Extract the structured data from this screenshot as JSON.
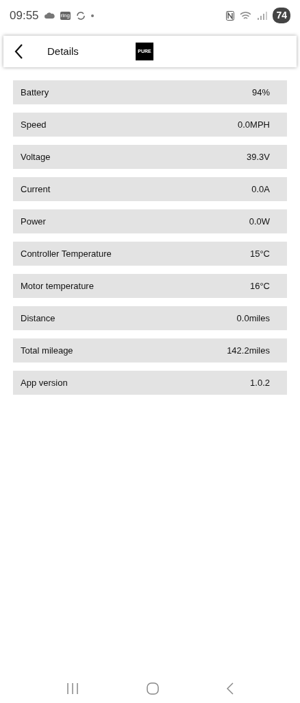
{
  "status_bar": {
    "time": "09:55",
    "app_badge": "ring",
    "battery": "74"
  },
  "header": {
    "title": "Details",
    "logo_text": "PURE"
  },
  "rows": [
    {
      "label": "Battery",
      "value": "94%"
    },
    {
      "label": "Speed",
      "value": "0.0MPH"
    },
    {
      "label": "Voltage",
      "value": "39.3V"
    },
    {
      "label": "Current",
      "value": "0.0A"
    },
    {
      "label": "Power",
      "value": "0.0W"
    },
    {
      "label": "Controller Temperature",
      "value": "15°C"
    },
    {
      "label": "Motor temperature",
      "value": "16°C"
    },
    {
      "label": "Distance",
      "value": "0.0miles"
    },
    {
      "label": "Total mileage",
      "value": "142.2miles"
    },
    {
      "label": "App version",
      "value": "1.0.2"
    }
  ]
}
